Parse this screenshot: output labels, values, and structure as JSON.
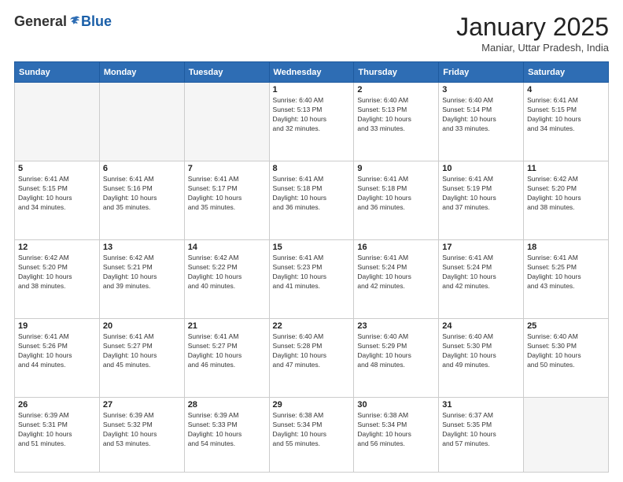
{
  "header": {
    "logo_general": "General",
    "logo_blue": "Blue",
    "title": "January 2025",
    "subtitle": "Maniar, Uttar Pradesh, India"
  },
  "days_of_week": [
    "Sunday",
    "Monday",
    "Tuesday",
    "Wednesday",
    "Thursday",
    "Friday",
    "Saturday"
  ],
  "weeks": [
    [
      {
        "day": "",
        "info": ""
      },
      {
        "day": "",
        "info": ""
      },
      {
        "day": "",
        "info": ""
      },
      {
        "day": "1",
        "info": "Sunrise: 6:40 AM\nSunset: 5:13 PM\nDaylight: 10 hours\nand 32 minutes."
      },
      {
        "day": "2",
        "info": "Sunrise: 6:40 AM\nSunset: 5:13 PM\nDaylight: 10 hours\nand 33 minutes."
      },
      {
        "day": "3",
        "info": "Sunrise: 6:40 AM\nSunset: 5:14 PM\nDaylight: 10 hours\nand 33 minutes."
      },
      {
        "day": "4",
        "info": "Sunrise: 6:41 AM\nSunset: 5:15 PM\nDaylight: 10 hours\nand 34 minutes."
      }
    ],
    [
      {
        "day": "5",
        "info": "Sunrise: 6:41 AM\nSunset: 5:15 PM\nDaylight: 10 hours\nand 34 minutes."
      },
      {
        "day": "6",
        "info": "Sunrise: 6:41 AM\nSunset: 5:16 PM\nDaylight: 10 hours\nand 35 minutes."
      },
      {
        "day": "7",
        "info": "Sunrise: 6:41 AM\nSunset: 5:17 PM\nDaylight: 10 hours\nand 35 minutes."
      },
      {
        "day": "8",
        "info": "Sunrise: 6:41 AM\nSunset: 5:18 PM\nDaylight: 10 hours\nand 36 minutes."
      },
      {
        "day": "9",
        "info": "Sunrise: 6:41 AM\nSunset: 5:18 PM\nDaylight: 10 hours\nand 36 minutes."
      },
      {
        "day": "10",
        "info": "Sunrise: 6:41 AM\nSunset: 5:19 PM\nDaylight: 10 hours\nand 37 minutes."
      },
      {
        "day": "11",
        "info": "Sunrise: 6:42 AM\nSunset: 5:20 PM\nDaylight: 10 hours\nand 38 minutes."
      }
    ],
    [
      {
        "day": "12",
        "info": "Sunrise: 6:42 AM\nSunset: 5:20 PM\nDaylight: 10 hours\nand 38 minutes."
      },
      {
        "day": "13",
        "info": "Sunrise: 6:42 AM\nSunset: 5:21 PM\nDaylight: 10 hours\nand 39 minutes."
      },
      {
        "day": "14",
        "info": "Sunrise: 6:42 AM\nSunset: 5:22 PM\nDaylight: 10 hours\nand 40 minutes."
      },
      {
        "day": "15",
        "info": "Sunrise: 6:41 AM\nSunset: 5:23 PM\nDaylight: 10 hours\nand 41 minutes."
      },
      {
        "day": "16",
        "info": "Sunrise: 6:41 AM\nSunset: 5:24 PM\nDaylight: 10 hours\nand 42 minutes."
      },
      {
        "day": "17",
        "info": "Sunrise: 6:41 AM\nSunset: 5:24 PM\nDaylight: 10 hours\nand 42 minutes."
      },
      {
        "day": "18",
        "info": "Sunrise: 6:41 AM\nSunset: 5:25 PM\nDaylight: 10 hours\nand 43 minutes."
      }
    ],
    [
      {
        "day": "19",
        "info": "Sunrise: 6:41 AM\nSunset: 5:26 PM\nDaylight: 10 hours\nand 44 minutes."
      },
      {
        "day": "20",
        "info": "Sunrise: 6:41 AM\nSunset: 5:27 PM\nDaylight: 10 hours\nand 45 minutes."
      },
      {
        "day": "21",
        "info": "Sunrise: 6:41 AM\nSunset: 5:27 PM\nDaylight: 10 hours\nand 46 minutes."
      },
      {
        "day": "22",
        "info": "Sunrise: 6:40 AM\nSunset: 5:28 PM\nDaylight: 10 hours\nand 47 minutes."
      },
      {
        "day": "23",
        "info": "Sunrise: 6:40 AM\nSunset: 5:29 PM\nDaylight: 10 hours\nand 48 minutes."
      },
      {
        "day": "24",
        "info": "Sunrise: 6:40 AM\nSunset: 5:30 PM\nDaylight: 10 hours\nand 49 minutes."
      },
      {
        "day": "25",
        "info": "Sunrise: 6:40 AM\nSunset: 5:30 PM\nDaylight: 10 hours\nand 50 minutes."
      }
    ],
    [
      {
        "day": "26",
        "info": "Sunrise: 6:39 AM\nSunset: 5:31 PM\nDaylight: 10 hours\nand 51 minutes."
      },
      {
        "day": "27",
        "info": "Sunrise: 6:39 AM\nSunset: 5:32 PM\nDaylight: 10 hours\nand 53 minutes."
      },
      {
        "day": "28",
        "info": "Sunrise: 6:39 AM\nSunset: 5:33 PM\nDaylight: 10 hours\nand 54 minutes."
      },
      {
        "day": "29",
        "info": "Sunrise: 6:38 AM\nSunset: 5:34 PM\nDaylight: 10 hours\nand 55 minutes."
      },
      {
        "day": "30",
        "info": "Sunrise: 6:38 AM\nSunset: 5:34 PM\nDaylight: 10 hours\nand 56 minutes."
      },
      {
        "day": "31",
        "info": "Sunrise: 6:37 AM\nSunset: 5:35 PM\nDaylight: 10 hours\nand 57 minutes."
      },
      {
        "day": "",
        "info": ""
      }
    ]
  ]
}
